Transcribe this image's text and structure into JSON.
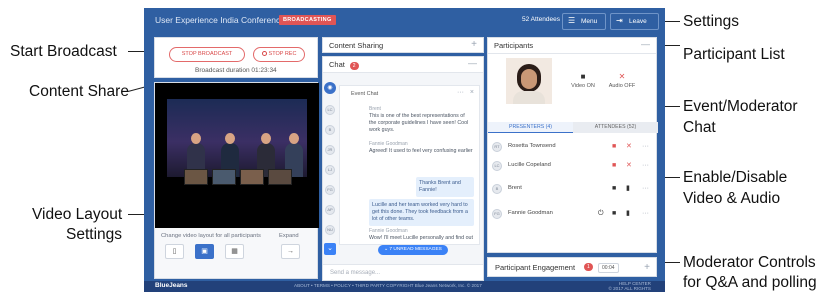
{
  "callouts": {
    "start_broadcast": "Start Broadcast",
    "content_share": "Content Share",
    "video_layout_1": "Video Layout",
    "video_layout_2": "Settings",
    "settings": "Settings",
    "participant_list": "Participant List",
    "event_chat_1": "Event/Moderator",
    "event_chat_2": "Chat",
    "enable_disable_1": "Enable/Disable",
    "enable_disable_2": "Video & Audio",
    "moderator_controls_1": "Moderator Controls",
    "moderator_controls_2": "for Q&A and polling"
  },
  "header": {
    "title": "User Experience India Conference",
    "badge": "BROADCASTING",
    "attendees": "52 Attendees",
    "menu_label": "Menu",
    "leave_label": "Leave"
  },
  "broadcast": {
    "stop_broadcast": "STOP BROADCAST",
    "stop_rec": "STOP REC",
    "duration": "Broadcast duration 01:23:34"
  },
  "video": {
    "layout_label": "Change video layout for all participants",
    "expand_label": "Expand"
  },
  "content_sharing": {
    "title": "Content Sharing"
  },
  "chat": {
    "title": "Chat",
    "unread_count": "2",
    "thread_title": "Event Chat",
    "messages": [
      {
        "name": "Brent",
        "text": "This is one of the best representations of the corporate guidelines I have seen! Cool work guys."
      },
      {
        "name": "Fannie Goodman",
        "text": "Agreed! It used to feel very confusing earlier"
      },
      {
        "name": "",
        "text": "Thanks Brent and Fannie!"
      },
      {
        "name": "",
        "text": "Lucille and her team worked very hard to get this done. They took feedback from a lot of other teams."
      },
      {
        "name": "Fannie Goodman",
        "text": "Wow! I'll meet Lucille personally and find out"
      }
    ],
    "side_avatars": [
      "LC",
      "B",
      "JR",
      "LJ",
      "FG",
      "AP",
      "NU"
    ],
    "unread_banner": "7 UNREAD MESSAGES",
    "input_placeholder": "Send a message..."
  },
  "participants": {
    "title": "Participants",
    "video_on": "Video ON",
    "audio_off": "Audio OFF",
    "tab_presenters": "PRESENTERS (4)",
    "tab_attendees": "ATTENDEES (52)",
    "rows": [
      {
        "initials": "RT",
        "name": "Rosetta Townsend"
      },
      {
        "initials": "LC",
        "name": "Lucille Copeland"
      },
      {
        "initials": "B",
        "name": "Brent"
      },
      {
        "initials": "FG",
        "name": "Fannie Goodman"
      }
    ]
  },
  "engagement": {
    "title": "Participant Engagement",
    "count": "1",
    "timer": "00:04"
  },
  "footer": {
    "brand": "BlueJeans",
    "links": "ABOUT  •  TERMS  •  POLICY  •  THIRD PARTY COPYRIGHT        Blue Jeans Network, Inc. © 2017",
    "help": "HELP CENTER",
    "copyright": "© 2017 ALL RIGHTS"
  },
  "colors": {
    "primary": "#2f5fa2",
    "accent": "#3b82f6",
    "alert": "#e05555"
  }
}
